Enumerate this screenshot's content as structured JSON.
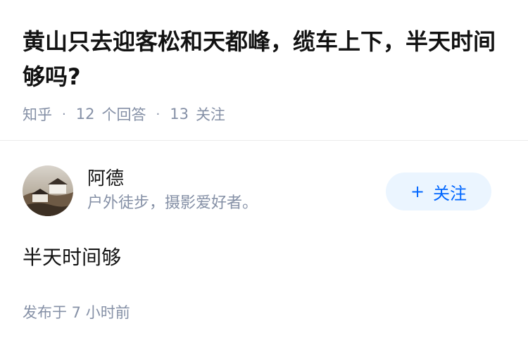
{
  "question": {
    "title": "黄山只去迎客松和天都峰，缆车上下，半天时间够吗?",
    "source": "知乎",
    "answer_count": "12",
    "answer_label": "个回答",
    "follow_count": "13",
    "follow_label": "关注"
  },
  "answer": {
    "author_name": "阿德",
    "author_bio": "户外徒步，摄影爱好者。",
    "follow_button_icon": "plus-icon",
    "follow_button_label": "关注",
    "content": "半天时间够",
    "publish_time": "发布于 7 小时前"
  },
  "colors": {
    "text_primary": "#121212",
    "text_secondary": "#8590a6",
    "accent": "#0066ff",
    "accent_bg": "#ebf5ff"
  }
}
